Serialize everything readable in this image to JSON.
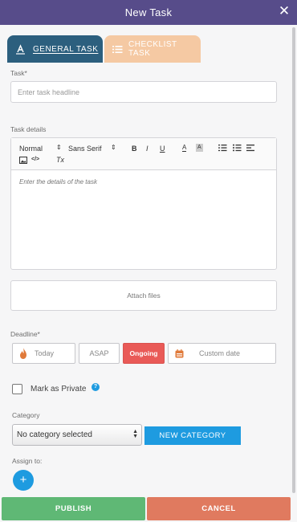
{
  "header": {
    "title": "New Task",
    "close_glyph": "✕"
  },
  "tabs": {
    "general": {
      "label": "GENERAL TASK",
      "icon": "text-a-icon"
    },
    "checklist": {
      "label": "CHECKLIST TASK",
      "icon": "list-icon"
    }
  },
  "task": {
    "label": "Task*",
    "placeholder": "Enter task headline",
    "value": ""
  },
  "details": {
    "label": "Task details",
    "toolbar": {
      "format": "Normal",
      "font": "Sans Serif",
      "bold": "B",
      "italic": "I",
      "underline": "U",
      "color": "A",
      "background": "A",
      "clear_format": "Tx",
      "code": "</>"
    },
    "placeholder": "Enter the details of the task"
  },
  "attach": {
    "label": "Attach files"
  },
  "deadline": {
    "label": "Deadline*",
    "options": {
      "today": "Today",
      "asap": "ASAP",
      "ongoing": "Ongoing",
      "custom": "Custom date"
    },
    "selected": "Ongoing"
  },
  "private": {
    "label": "Mark as Private",
    "help": "?",
    "checked": false
  },
  "category": {
    "label": "Category",
    "selected": "No category selected",
    "new_button": "NEW CATEGORY"
  },
  "assign": {
    "label": "Assign to:",
    "add": "+"
  },
  "footer": {
    "publish": "PUBLISH",
    "cancel": "CANCEL"
  },
  "colors": {
    "header_bg": "#574c8a",
    "tab_active": "#2c5f7e",
    "tab_inactive": "#f5c9a3",
    "ongoing": "#e95a57",
    "accent_blue": "#1e9be0",
    "publish": "#5fb875",
    "cancel": "#e07a5f"
  }
}
